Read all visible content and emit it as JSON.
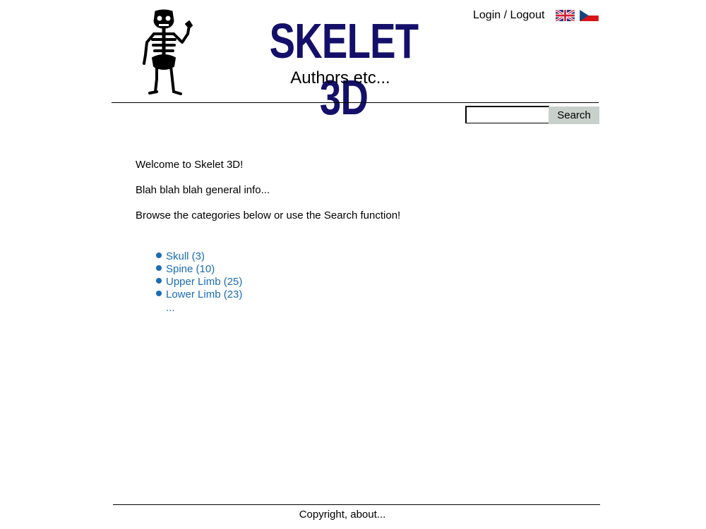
{
  "header": {
    "brand_title": "SKELET 3D",
    "brand_subtitle": "Authors etc...",
    "login_label": "Login / Logout",
    "languages": [
      {
        "code": "en",
        "icon": "uk-flag-icon"
      },
      {
        "code": "cs",
        "icon": "czech-flag-icon"
      }
    ]
  },
  "search": {
    "value": "",
    "placeholder": "",
    "button_label": "Search"
  },
  "main": {
    "welcome": "Welcome to Skelet 3D!",
    "info": "Blah blah blah general info...",
    "browse_hint": "Browse the categories below or use the Search function!",
    "categories": [
      {
        "label": "Skull (3)"
      },
      {
        "label": "Spine (10)"
      },
      {
        "label": "Upper Limb (25)"
      },
      {
        "label": "Lower Limb (23)"
      }
    ],
    "more_label": "..."
  },
  "footer": {
    "text": "Copyright, about..."
  },
  "colors": {
    "brand": "#14106a",
    "link": "#1a6cb5",
    "search_button_bg": "#c8d0cc",
    "uk_blue": "#2b2f7e",
    "uk_red": "#cf2030",
    "cz_blue": "#11457e",
    "cz_red": "#d7141a"
  }
}
